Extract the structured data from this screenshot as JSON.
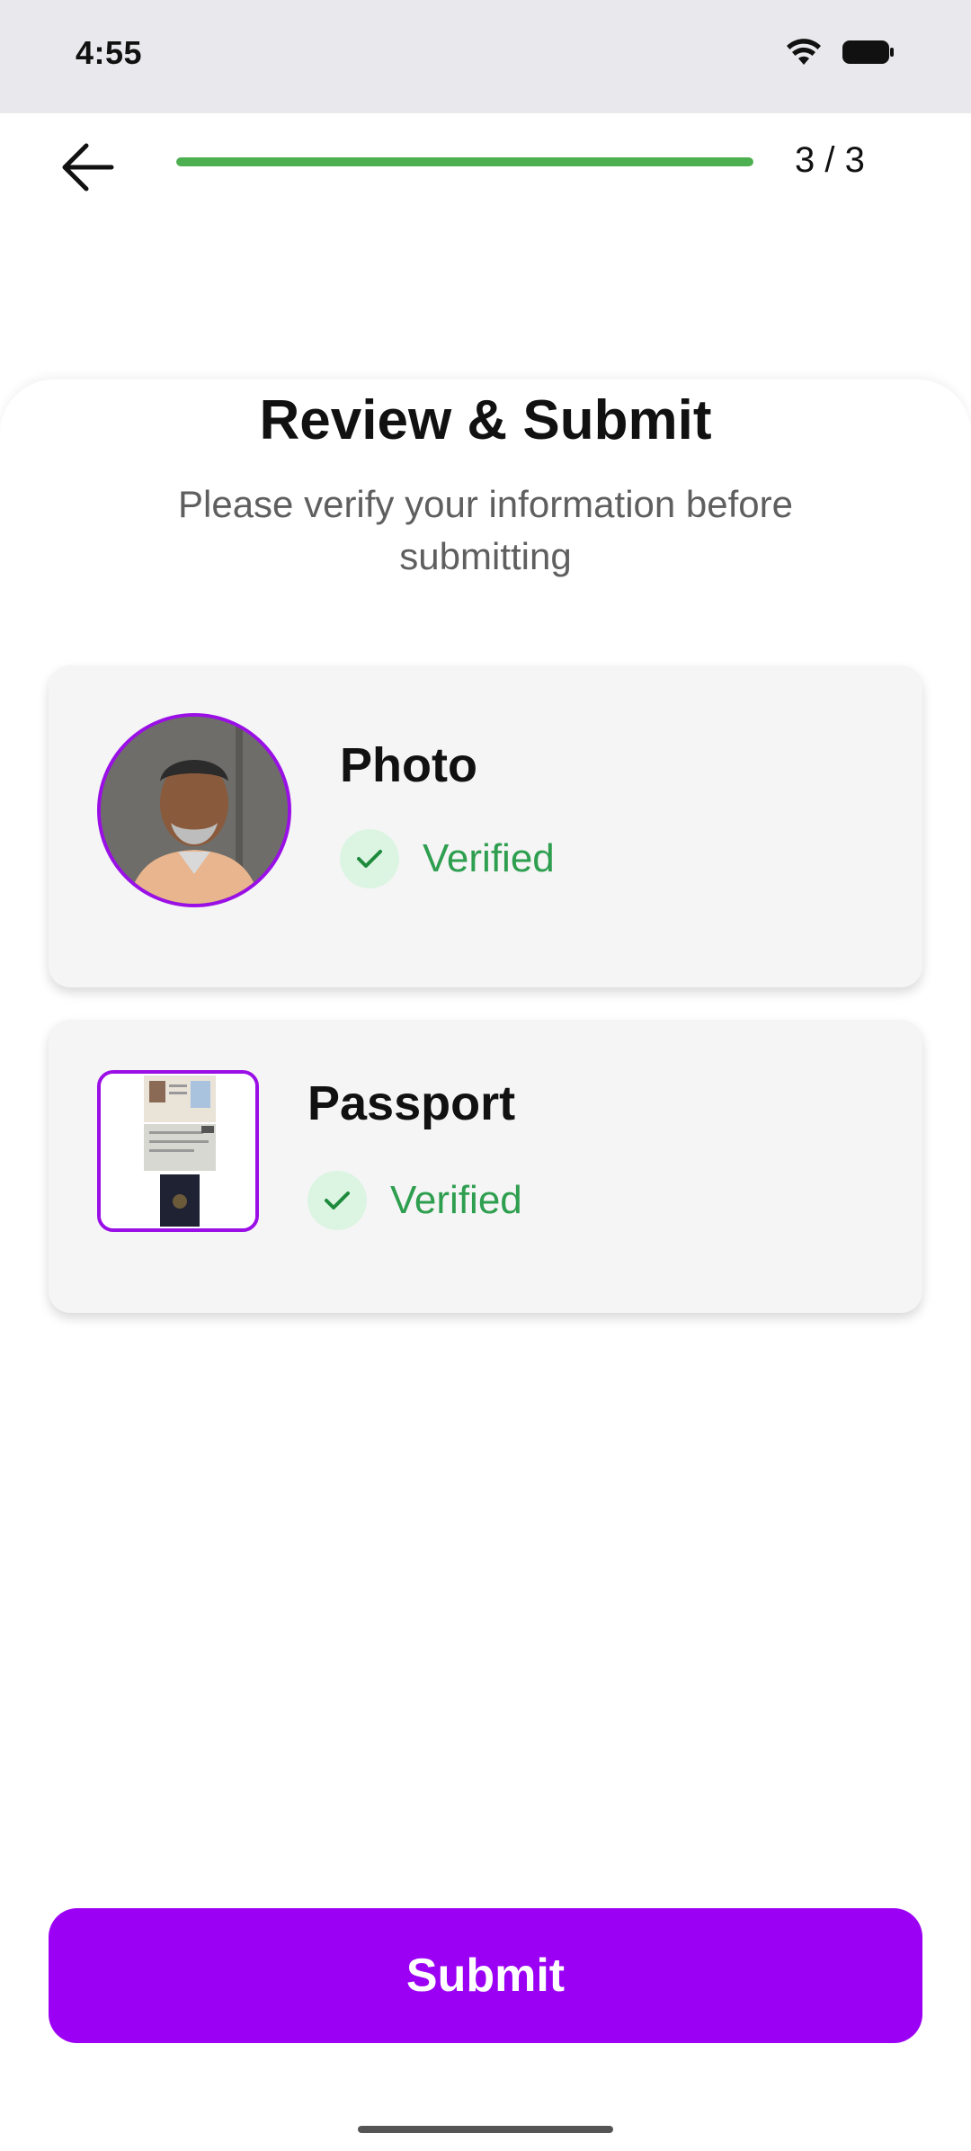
{
  "status_bar": {
    "time": "4:55",
    "icons": [
      "wifi-icon",
      "battery-icon"
    ]
  },
  "header": {
    "back_icon": "arrow-left-icon",
    "progress_fraction": 1.0,
    "step_label": "3 / 3",
    "progress_color": "#4caf50"
  },
  "main": {
    "title": "Review & Submit",
    "subtitle": "Please verify your information before submitting"
  },
  "cards": {
    "photo": {
      "title": "Photo",
      "status": "Verified",
      "thumbnail": "user-photo"
    },
    "passport": {
      "title": "Passport",
      "status": "Verified",
      "thumbnail": "passport-document"
    }
  },
  "actions": {
    "submit_label": "Submit"
  },
  "colors": {
    "accent": "#9b00f5",
    "verified_green": "#2e9e4f",
    "verified_bg": "#dcf5e3"
  }
}
